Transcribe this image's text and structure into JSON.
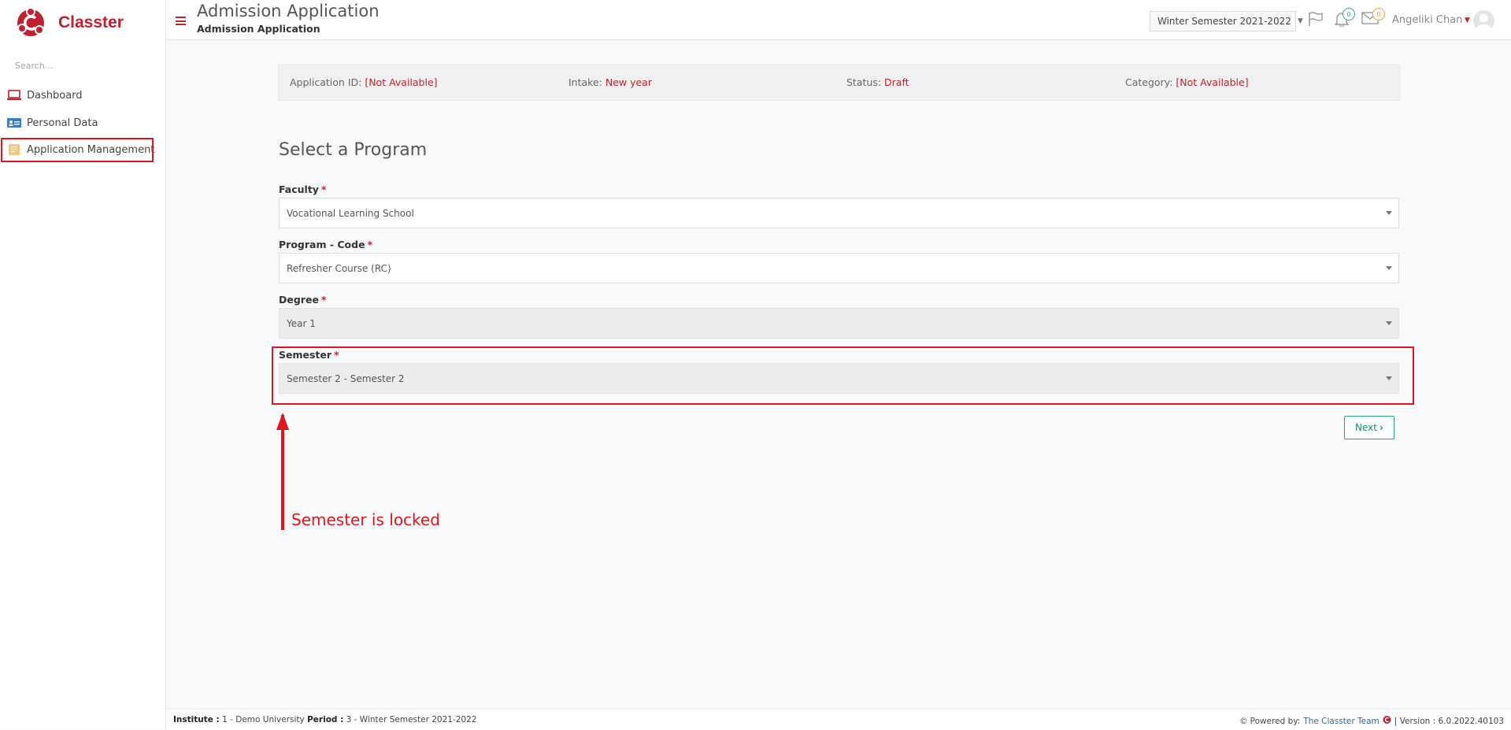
{
  "brand": {
    "name": "Classter",
    "accent": "#c0202f"
  },
  "sidebar": {
    "search_placeholder": "Search...",
    "items": [
      {
        "label": "Dashboard",
        "icon": "laptop-icon"
      },
      {
        "label": "Personal Data",
        "icon": "id-card-icon"
      },
      {
        "label": "Application Management",
        "icon": "document-icon"
      }
    ]
  },
  "header": {
    "title": "Admission Application",
    "subtitle": "Admission Application",
    "period": "Winter Semester 2021-2022",
    "notifications_count": "0",
    "messages_count": "0",
    "user_name": "Angeliki Chan"
  },
  "info": {
    "application_id_label": "Application ID:",
    "application_id_value": "[Not Available]",
    "intake_label": "Intake:",
    "intake_value": "New year",
    "status_label": "Status:",
    "status_value": "Draft",
    "category_label": "Category:",
    "category_value": "[Not Available]"
  },
  "form": {
    "title": "Select a Program",
    "required_mark": "*",
    "faculty_label": "Faculty",
    "faculty_value": "Vocational Learning School",
    "program_label": "Program - Code",
    "program_value": "Refresher Course (RC)",
    "degree_label": "Degree",
    "degree_value": "Year 1",
    "semester_label": "Semester",
    "semester_value": "Semester 2 - Semester 2",
    "next_label": "Next"
  },
  "annotation": {
    "text": "Semester is locked"
  },
  "footer": {
    "institute_label": "Institute :",
    "institute_value": "1 - Demo University",
    "period_label": "Period :",
    "period_value": "3 - Winter Semester 2021-2022",
    "powered_label": "Powered by:",
    "powered_link": "The Classter Team",
    "version": "| Version : 6.0.2022.40103"
  }
}
